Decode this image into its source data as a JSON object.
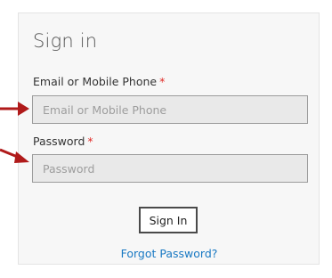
{
  "form": {
    "title": "Sign in",
    "email": {
      "label": "Email or Mobile Phone",
      "required_mark": "*",
      "placeholder": "Email or Mobile Phone",
      "value": ""
    },
    "password": {
      "label": "Password",
      "required_mark": "*",
      "placeholder": "Password",
      "value": ""
    },
    "submit_label": "Sign In",
    "forgot_link": "Forgot Password?"
  },
  "colors": {
    "required": "#e02b27",
    "link": "#1979c3",
    "annotation_arrow": "#b01a1a"
  },
  "annotations": {
    "arrows": [
      "arrow-icon",
      "arrow-icon"
    ]
  }
}
